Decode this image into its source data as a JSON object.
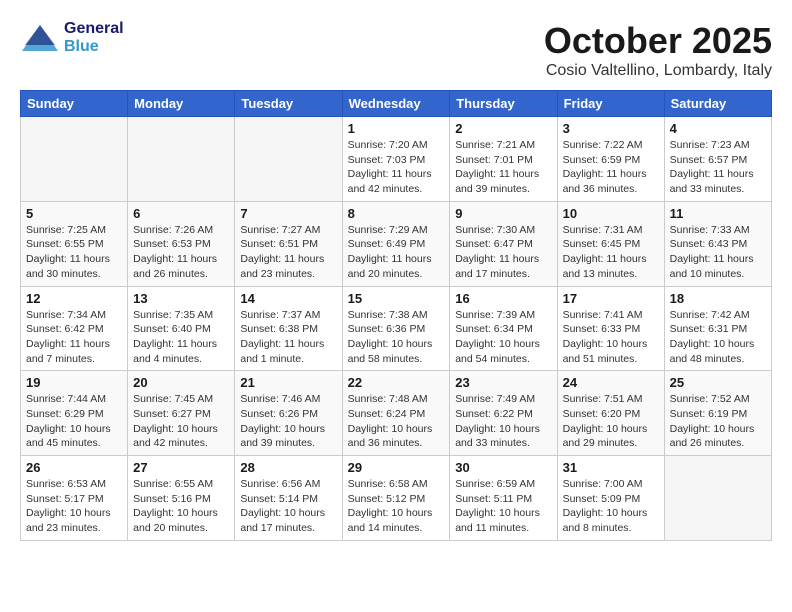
{
  "header": {
    "logo_general": "General",
    "logo_blue": "Blue",
    "month_title": "October 2025",
    "location": "Cosio Valtellino, Lombardy, Italy"
  },
  "weekdays": [
    "Sunday",
    "Monday",
    "Tuesday",
    "Wednesday",
    "Thursday",
    "Friday",
    "Saturday"
  ],
  "weeks": [
    [
      {
        "day": "",
        "info": ""
      },
      {
        "day": "",
        "info": ""
      },
      {
        "day": "",
        "info": ""
      },
      {
        "day": "1",
        "info": "Sunrise: 7:20 AM\nSunset: 7:03 PM\nDaylight: 11 hours\nand 42 minutes."
      },
      {
        "day": "2",
        "info": "Sunrise: 7:21 AM\nSunset: 7:01 PM\nDaylight: 11 hours\nand 39 minutes."
      },
      {
        "day": "3",
        "info": "Sunrise: 7:22 AM\nSunset: 6:59 PM\nDaylight: 11 hours\nand 36 minutes."
      },
      {
        "day": "4",
        "info": "Sunrise: 7:23 AM\nSunset: 6:57 PM\nDaylight: 11 hours\nand 33 minutes."
      }
    ],
    [
      {
        "day": "5",
        "info": "Sunrise: 7:25 AM\nSunset: 6:55 PM\nDaylight: 11 hours\nand 30 minutes."
      },
      {
        "day": "6",
        "info": "Sunrise: 7:26 AM\nSunset: 6:53 PM\nDaylight: 11 hours\nand 26 minutes."
      },
      {
        "day": "7",
        "info": "Sunrise: 7:27 AM\nSunset: 6:51 PM\nDaylight: 11 hours\nand 23 minutes."
      },
      {
        "day": "8",
        "info": "Sunrise: 7:29 AM\nSunset: 6:49 PM\nDaylight: 11 hours\nand 20 minutes."
      },
      {
        "day": "9",
        "info": "Sunrise: 7:30 AM\nSunset: 6:47 PM\nDaylight: 11 hours\nand 17 minutes."
      },
      {
        "day": "10",
        "info": "Sunrise: 7:31 AM\nSunset: 6:45 PM\nDaylight: 11 hours\nand 13 minutes."
      },
      {
        "day": "11",
        "info": "Sunrise: 7:33 AM\nSunset: 6:43 PM\nDaylight: 11 hours\nand 10 minutes."
      }
    ],
    [
      {
        "day": "12",
        "info": "Sunrise: 7:34 AM\nSunset: 6:42 PM\nDaylight: 11 hours\nand 7 minutes."
      },
      {
        "day": "13",
        "info": "Sunrise: 7:35 AM\nSunset: 6:40 PM\nDaylight: 11 hours\nand 4 minutes."
      },
      {
        "day": "14",
        "info": "Sunrise: 7:37 AM\nSunset: 6:38 PM\nDaylight: 11 hours\nand 1 minute."
      },
      {
        "day": "15",
        "info": "Sunrise: 7:38 AM\nSunset: 6:36 PM\nDaylight: 10 hours\nand 58 minutes."
      },
      {
        "day": "16",
        "info": "Sunrise: 7:39 AM\nSunset: 6:34 PM\nDaylight: 10 hours\nand 54 minutes."
      },
      {
        "day": "17",
        "info": "Sunrise: 7:41 AM\nSunset: 6:33 PM\nDaylight: 10 hours\nand 51 minutes."
      },
      {
        "day": "18",
        "info": "Sunrise: 7:42 AM\nSunset: 6:31 PM\nDaylight: 10 hours\nand 48 minutes."
      }
    ],
    [
      {
        "day": "19",
        "info": "Sunrise: 7:44 AM\nSunset: 6:29 PM\nDaylight: 10 hours\nand 45 minutes."
      },
      {
        "day": "20",
        "info": "Sunrise: 7:45 AM\nSunset: 6:27 PM\nDaylight: 10 hours\nand 42 minutes."
      },
      {
        "day": "21",
        "info": "Sunrise: 7:46 AM\nSunset: 6:26 PM\nDaylight: 10 hours\nand 39 minutes."
      },
      {
        "day": "22",
        "info": "Sunrise: 7:48 AM\nSunset: 6:24 PM\nDaylight: 10 hours\nand 36 minutes."
      },
      {
        "day": "23",
        "info": "Sunrise: 7:49 AM\nSunset: 6:22 PM\nDaylight: 10 hours\nand 33 minutes."
      },
      {
        "day": "24",
        "info": "Sunrise: 7:51 AM\nSunset: 6:20 PM\nDaylight: 10 hours\nand 29 minutes."
      },
      {
        "day": "25",
        "info": "Sunrise: 7:52 AM\nSunset: 6:19 PM\nDaylight: 10 hours\nand 26 minutes."
      }
    ],
    [
      {
        "day": "26",
        "info": "Sunrise: 6:53 AM\nSunset: 5:17 PM\nDaylight: 10 hours\nand 23 minutes."
      },
      {
        "day": "27",
        "info": "Sunrise: 6:55 AM\nSunset: 5:16 PM\nDaylight: 10 hours\nand 20 minutes."
      },
      {
        "day": "28",
        "info": "Sunrise: 6:56 AM\nSunset: 5:14 PM\nDaylight: 10 hours\nand 17 minutes."
      },
      {
        "day": "29",
        "info": "Sunrise: 6:58 AM\nSunset: 5:12 PM\nDaylight: 10 hours\nand 14 minutes."
      },
      {
        "day": "30",
        "info": "Sunrise: 6:59 AM\nSunset: 5:11 PM\nDaylight: 10 hours\nand 11 minutes."
      },
      {
        "day": "31",
        "info": "Sunrise: 7:00 AM\nSunset: 5:09 PM\nDaylight: 10 hours\nand 8 minutes."
      },
      {
        "day": "",
        "info": ""
      }
    ]
  ]
}
